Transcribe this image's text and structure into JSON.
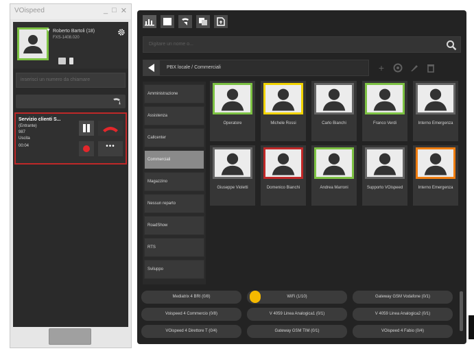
{
  "phone": {
    "title": "VOispeed",
    "window_buttons": [
      "_",
      "□",
      "✕"
    ],
    "user_name": "Roberto Bartoli (18)",
    "user_extension": "FXS-1408.020",
    "dial_placeholder": "inserisci un numero da chiamare",
    "call": {
      "name": "Servizio clienti S...",
      "lines": [
        "(Entrante)",
        "987",
        "Uscita",
        "00:04"
      ]
    },
    "more_label": "•••"
  },
  "panel": {
    "search_placeholder": "Digitare un nome o...",
    "path": "PBX locale / Commerciali",
    "groups": [
      "Amministrazione",
      "Assistenza",
      "Callcenter",
      "Commerciali",
      "Magazzino",
      "Nessun reparto",
      "RoadShow",
      "RTS",
      "Sviluppo"
    ],
    "selected_group": "Commerciali",
    "contacts": [
      {
        "name": "Operatore",
        "status": "available",
        "color": "#7dc243"
      },
      {
        "name": "Michele Rossi",
        "status": "ringing",
        "color": "#f2d400"
      },
      {
        "name": "Carlo Bianchi",
        "status": "offline",
        "color": "#666666"
      },
      {
        "name": "Franco Verdi",
        "status": "available",
        "color": "#7dc243"
      },
      {
        "name": "Interno Emergenza",
        "status": "offline",
        "color": "#666666"
      },
      {
        "name": "Giuseppe Violetti",
        "status": "offline",
        "color": "#666666"
      },
      {
        "name": "Domenico Bianchi",
        "status": "busy",
        "color": "#c02828"
      },
      {
        "name": "Andrea Marroni",
        "status": "available",
        "color": "#7dc243"
      },
      {
        "name": "Supporto VOispeed",
        "status": "offline",
        "color": "#666666"
      },
      {
        "name": "Interno Emergenza",
        "status": "away",
        "color": "#ef7d10"
      }
    ],
    "trunks": [
      "Mediatrix 4 BRI (0/8)",
      "WiFi (1/10)",
      "Gateway GSM Vodafone (0/1)",
      "Voispeed 4 Commercio (0/8)",
      "V 4059 Linea Analogica1 (0/1)",
      "V 4059 Linea Analogica2 (0/1)",
      "VOispeed 4 Direttore T (0/4)",
      "Gateway GSM TIM (0/1)",
      "VOispeed 4 Fabio (0/4)"
    ]
  }
}
